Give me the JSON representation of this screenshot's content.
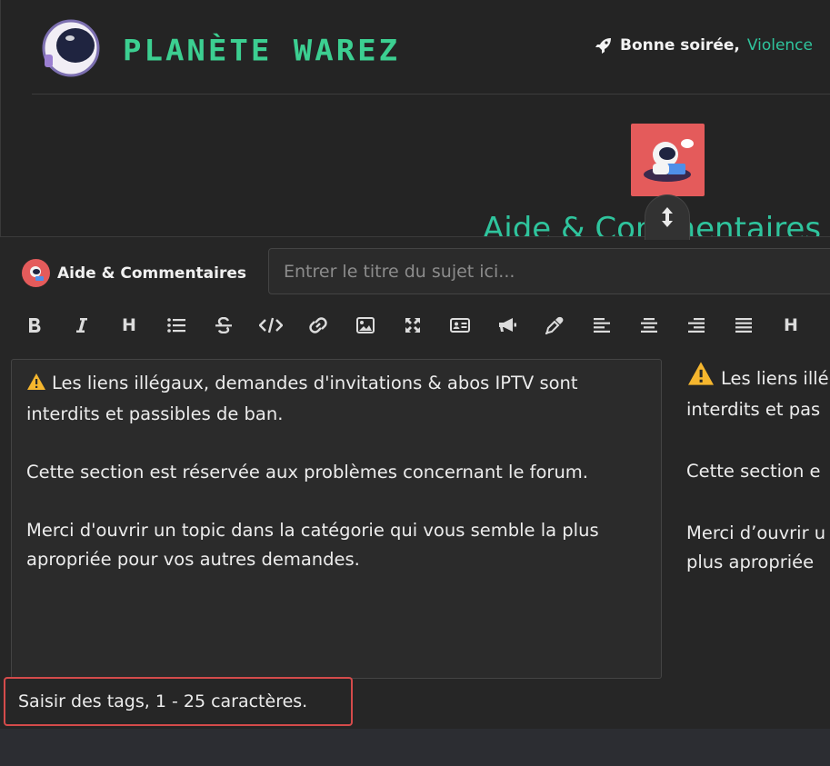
{
  "header": {
    "brand": "PLANÈTE WAREZ",
    "greeting": "Bonne soirée,",
    "username": "Violence",
    "logo_icon": "astronaut-helmet-icon",
    "greet_icon": "rocket-icon"
  },
  "category": {
    "title": "Aide & Commentaires",
    "avatar_icon": "astronaut-laptop-icon"
  },
  "composer": {
    "category_chip": "Aide & Commentaires",
    "title_placeholder": "Entrer le titre du sujet ici...",
    "toolbar": [
      "bold",
      "italic",
      "heading",
      "list",
      "strikethrough",
      "code",
      "link",
      "image",
      "fullscreen",
      "card",
      "megaphone",
      "color-picker",
      "align-left",
      "align-center",
      "align-right",
      "justify",
      "heading-2"
    ],
    "heading_glyph": "H",
    "editor": {
      "p1": "Les liens illégaux, demandes d'invitations & abos IPTV sont interdits et passibles de ban.",
      "p2": "Cette section est réservée aux problèmes concernant le forum.",
      "p3": "Merci d'ouvrir un topic dans la catégorie qui vous semble la plus apropriée pour vos autres demandes."
    },
    "preview": {
      "l1": "Les liens illé",
      "l2": "interdits et pas",
      "l3": "Cette section e",
      "l4": "Merci d’ouvrir u",
      "l5": "plus apropriée"
    },
    "tags_placeholder": "Saisir des tags, 1 - 25 caractères."
  },
  "colors": {
    "accent": "#2fc49d",
    "brand": "#3ccf91",
    "avatar_bg": "#e45b5b",
    "highlight": "#d44b4b"
  }
}
